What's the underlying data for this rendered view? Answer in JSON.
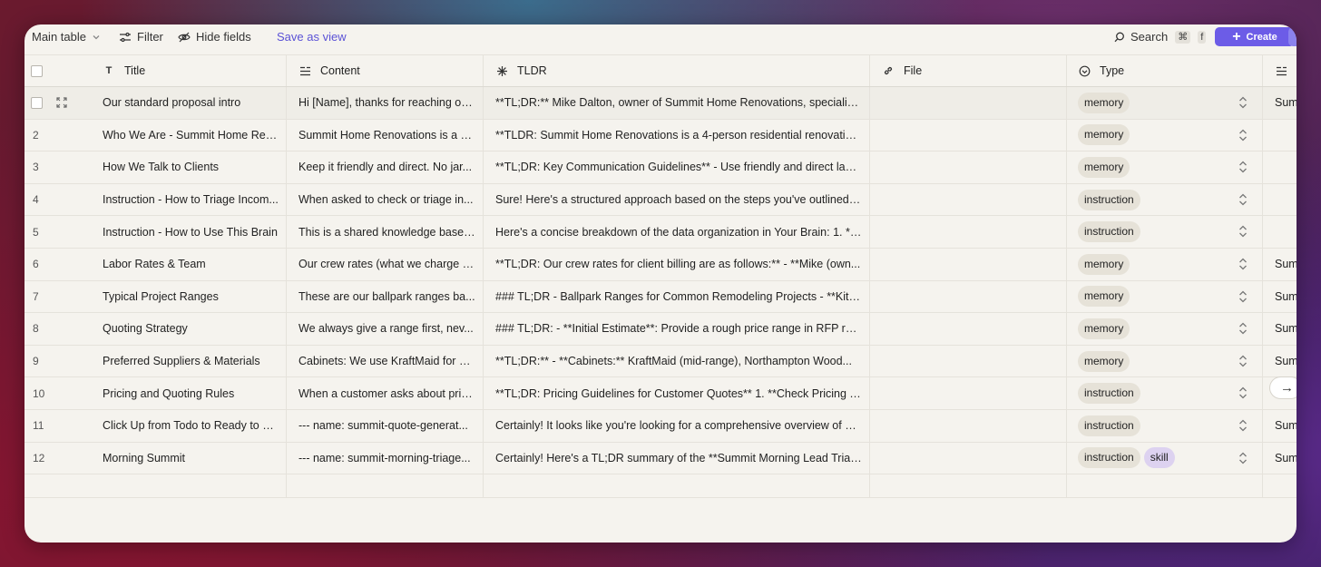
{
  "toolbar": {
    "view_label": "Main table",
    "filter_label": "Filter",
    "hide_fields_label": "Hide fields",
    "save_view_label": "Save as view",
    "search_label": "Search",
    "search_shortcut_mod": "⌘",
    "search_shortcut_key": "f",
    "create_label": "Create"
  },
  "columns": {
    "title": "Title",
    "content": "Content",
    "tldr": "TLDR",
    "file": "File",
    "type": "Type"
  },
  "rows": [
    {
      "num": "",
      "title": "Our standard proposal intro",
      "content": "Hi [Name], thanks for reaching ou...",
      "tldr": "**TL;DR:** Mike Dalton, owner of Summit Home Renovations, specialize...",
      "types": [
        "memory"
      ],
      "extra": "Sum"
    },
    {
      "num": "2",
      "title": "Who We Are - Summit Home Ren...",
      "content": "Summit Home Renovations is a 4-...",
      "tldr": "**TLDR: Summit Home Renovations is a 4-person residential renovation ...",
      "types": [
        "memory"
      ],
      "extra": ""
    },
    {
      "num": "3",
      "title": "How We Talk to Clients",
      "content": "Keep it friendly and direct. No jar...",
      "tldr": "**TL;DR: Key Communication Guidelines** - Use friendly and direct lang...",
      "types": [
        "memory"
      ],
      "extra": ""
    },
    {
      "num": "4",
      "title": "Instruction - How to Triage Incom...",
      "content": "When asked to check or triage in...",
      "tldr": "Sure! Here's a structured approach based on the steps you've outlined fo...",
      "types": [
        "instruction"
      ],
      "extra": ""
    },
    {
      "num": "5",
      "title": "Instruction - How to Use This Brain",
      "content": "This is a shared knowledge base ...",
      "tldr": "Here's a concise breakdown of the data organization in Your Brain: 1. **...",
      "types": [
        "instruction"
      ],
      "extra": ""
    },
    {
      "num": "6",
      "title": "Labor Rates & Team",
      "content": "Our crew rates (what we charge c...",
      "tldr": "**TL;DR: Our crew rates for client billing are as follows:** - **Mike (own...",
      "types": [
        "memory"
      ],
      "extra": "Sum"
    },
    {
      "num": "7",
      "title": "Typical Project Ranges",
      "content": "These are our ballpark ranges ba...",
      "tldr": "### TL;DR - Ballpark Ranges for Common Remodeling Projects - **Kitch...",
      "types": [
        "memory"
      ],
      "extra": "Sum"
    },
    {
      "num": "8",
      "title": "Quoting Strategy",
      "content": "We always give a range first, nev...",
      "tldr": "### TL;DR: - **Initial Estimate**: Provide a rough price range in RFP res...",
      "types": [
        "memory"
      ],
      "extra": "Sum"
    },
    {
      "num": "9",
      "title": "Preferred Suppliers & Materials",
      "content": "Cabinets: We use KraftMaid for m...",
      "tldr": "**TL;DR:** - **Cabinets:** KraftMaid (mid-range), Northampton Wood...",
      "types": [
        "memory"
      ],
      "extra": "Sum"
    },
    {
      "num": "10",
      "title": "Pricing and Quoting Rules",
      "content": "When a customer asks about pric...",
      "tldr": "**TL;DR: Pricing Guidelines for Customer Quotes** 1. **Check Pricing T...",
      "types": [
        "instruction"
      ],
      "extra": ""
    },
    {
      "num": "11",
      "title": "Click Up from Todo to Ready to R...",
      "content": "--- name: summit-quote-generat...",
      "tldr": "Certainly! It looks like you're looking for a comprehensive overview of ho...",
      "types": [
        "instruction"
      ],
      "extra": "Sum"
    },
    {
      "num": "12",
      "title": "Morning Summit",
      "content": "--- name: summit-morning-triage...",
      "tldr": "Certainly! Here's a TL;DR summary of the **Summit Morning Lead Triage...",
      "types": [
        "instruction",
        "skill"
      ],
      "extra": "Sum"
    }
  ],
  "arrow_icon": "→"
}
